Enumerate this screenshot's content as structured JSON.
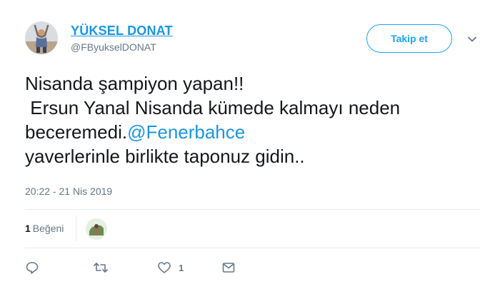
{
  "user": {
    "display_name": "YÜKSEL DONAT",
    "handle": "@FByukselDONAT",
    "avatar_icon": "profile-photo"
  },
  "header": {
    "follow_label": "Takip et",
    "menu_icon": "chevron-down-icon"
  },
  "tweet": {
    "line1": "Nisanda şampiyon yapan!!",
    "line2": " Ersun Yanal Nisanda kümede kalmayı neden",
    "line3_prefix": "beceremedi.",
    "line3_mention": "@Fenerbahce",
    "line4": "yaverlerinle birlikte taponuz gidin.."
  },
  "timestamp": "20:22 - 21 Nis 2019",
  "stats": {
    "likes_count": "1",
    "likes_label": "Beğeni"
  },
  "actions": {
    "reply_icon": "reply-icon",
    "retweet_icon": "retweet-icon",
    "like_icon": "heart-icon",
    "like_count": "1",
    "dm_icon": "envelope-icon"
  },
  "colors": {
    "accent": "#1da1f2",
    "link": "#1b95e0",
    "muted": "#657786",
    "divider": "#e6ecf0"
  }
}
